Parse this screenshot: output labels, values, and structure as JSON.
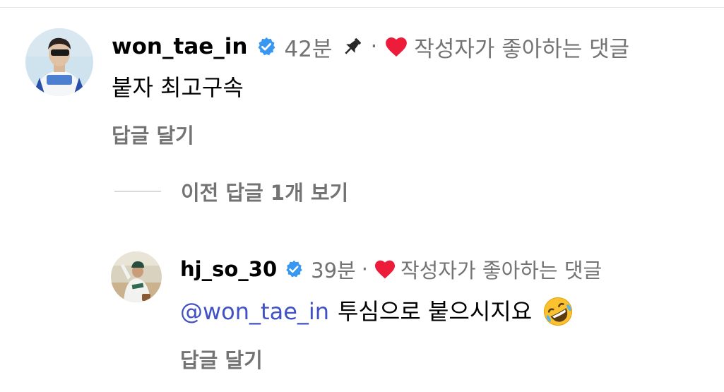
{
  "comments": [
    {
      "username": "won_tae_in",
      "time": "42분",
      "dot": "·",
      "liked_label": "작성자가 좋아하는 댓글",
      "text": "붙자 최고구속",
      "reply_label": "답글 달기"
    }
  ],
  "view_previous_label": "이전 답글 1개 보기",
  "replies": [
    {
      "username": "hj_so_30",
      "time": "39분",
      "dot": "·",
      "liked_label": "작성자가 좋아하는 댓글",
      "mention": "@won_tae_in",
      "text": "투심으로 붙으시지요",
      "emoji": "🤣",
      "reply_label": "답글 달기"
    }
  ],
  "colors": {
    "verified": "#3897f0",
    "heart": "#ed1c3a",
    "mention": "#3f51c4",
    "secondary_text": "#737373"
  },
  "icons": [
    "verified-badge-icon",
    "pin-icon",
    "heart-icon",
    "rofl-emoji"
  ]
}
